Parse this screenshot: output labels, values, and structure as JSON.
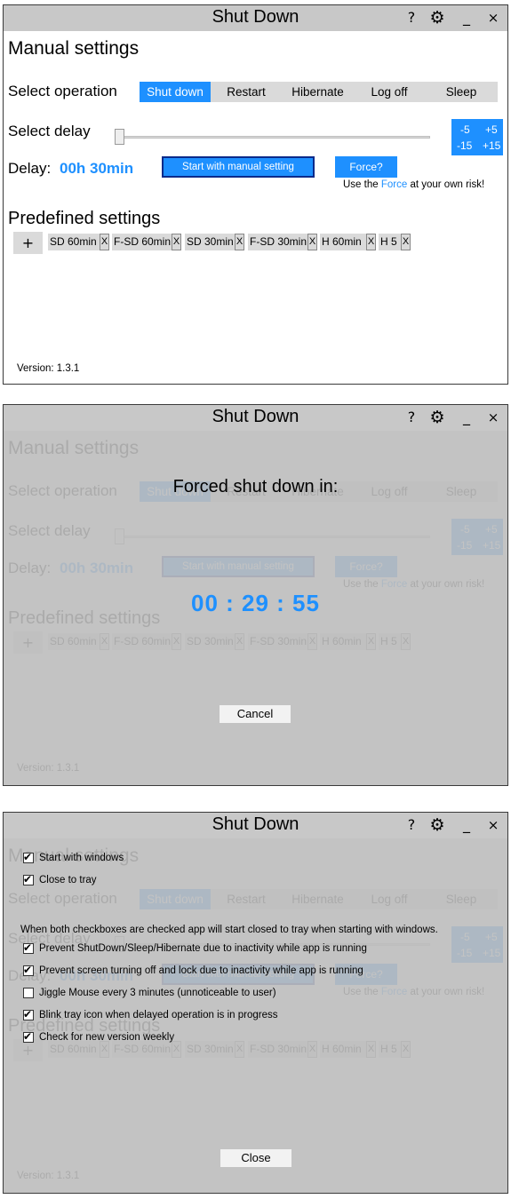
{
  "app": {
    "title": "Shut Down",
    "help_glyph": "?",
    "settings_icon": "gear-icon",
    "minimize_glyph": "_",
    "close_glyph": "×"
  },
  "main": {
    "manual_heading": "Manual settings",
    "select_operation_label": "Select operation",
    "operations": [
      "Shut down",
      "Restart",
      "Hibernate",
      "Log off",
      "Sleep"
    ],
    "active_operation": "Shut down",
    "select_delay_label": "Select delay",
    "delay_adjust": [
      "-5",
      "+5",
      "-15",
      "+15"
    ],
    "delay_label": "Delay:",
    "delay_value": "00h 30min",
    "start_button": "Start with manual setting",
    "force_button": "Force?",
    "force_note_prefix": "Use the",
    "force_note_link": "Force",
    "force_note_suffix": "at your own risk!",
    "predefined_heading": "Predefined settings",
    "add_preset": "+",
    "presets": [
      "SD 60min",
      "F-SD 60min",
      "SD 30min",
      "F-SD 30min",
      "H 60min",
      "H 5"
    ],
    "preset_remove": "X",
    "version": "Version: 1.3.1"
  },
  "forced_dialog": {
    "title": "Forced shut down in:",
    "countdown": "00 : 29 : 55",
    "cancel_button": "Cancel"
  },
  "settings_dialog": {
    "options": [
      {
        "label": "Start with windows",
        "checked": true
      },
      {
        "label": "Close to tray",
        "checked": true
      },
      {
        "label": "Prevent ShutDown/Sleep/Hibernate due to inactivity while app is running",
        "checked": true
      },
      {
        "label": "Prevent screen turning off and lock due to inactivity while app is running",
        "checked": true
      },
      {
        "label": "Jiggle Mouse every 3 minutes (unnoticeable to user)",
        "checked": false
      },
      {
        "label": "Blink tray icon when delayed operation is in progress",
        "checked": true
      },
      {
        "label": "Check for new version weekly",
        "checked": true
      }
    ],
    "tray_note": "When both checkboxes are checked app will start closed to tray when starting with windows.",
    "close_button": "Close"
  },
  "colors": {
    "accent": "#1e90ff",
    "titlebar": "#c8c8c8",
    "control_bg": "#dadada",
    "overlay": "#bcbcbc",
    "start_border": "#0b2a8a"
  }
}
